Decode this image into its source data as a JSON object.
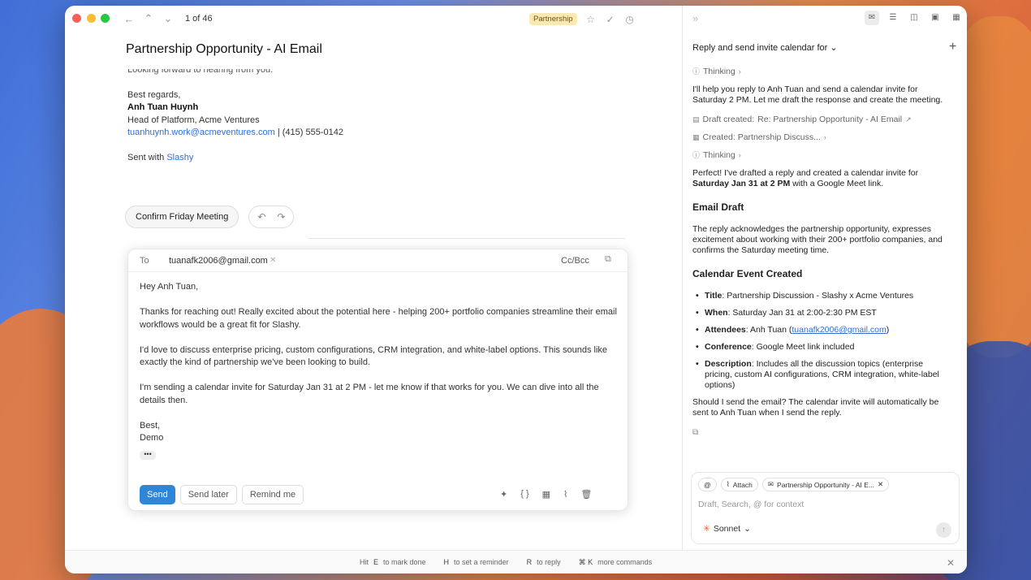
{
  "nav": {
    "counter": "1 of 46",
    "tag": "Partnership"
  },
  "email": {
    "subject": "Partnership Opportunity - AI Email",
    "closing_line": "Looking forward to hearing from you.",
    "regards": "Best regards,",
    "sender_name": "Anh Tuan Huynh",
    "sender_title": "Head of Platform, Acme Ventures",
    "sender_email": "tuanhuynh.work@acmeventures.com",
    "sender_phone": " | (415) 555-0142",
    "sent_with_prefix": "Sent with ",
    "sent_with_link": "Slashy"
  },
  "quick_reply": {
    "label": "Confirm Friday Meeting"
  },
  "compose": {
    "to_label": "To",
    "to_email": "tuanafk2006@gmail.com",
    "ccbcc": "Cc/Bcc",
    "greeting": "Hey Anh Tuan,",
    "p1": "Thanks for reaching out! Really excited about the potential here - helping 200+ portfolio companies streamline their email workflows would be a great fit for Slashy.",
    "p2": "I'd love to discuss enterprise pricing, custom configurations, CRM integration, and white-label options. This sounds like exactly the kind of partnership we've been looking to build.",
    "p3": "I'm sending a calendar invite for Saturday Jan 31 at 2 PM - let me know if that works for you. We can dive into all the details then.",
    "signoff": "Best,",
    "signature": "Demo",
    "more": "•••",
    "send": "Send",
    "send_later": "Send later",
    "remind_me": "Remind me"
  },
  "assistant": {
    "title": "Reply and send invite calendar for",
    "thinking": "Thinking",
    "intro": "I'll help you reply to Anh Tuan and send a calendar invite for Saturday 2 PM. Let me draft the response and create the meeting.",
    "draft_created_label": "Draft created:",
    "draft_created_value": "Re: Partnership Opportunity - AI Email",
    "created_label": "Created: Partnership Discuss...",
    "perfect_prefix": "Perfect! I've drafted a reply and created a calendar invite for ",
    "perfect_bold": "Saturday Jan 31 at 2 PM",
    "perfect_suffix": " with a Google Meet link.",
    "email_draft_heading": "Email Draft",
    "email_draft_text": "The reply acknowledges the partnership opportunity, expresses excitement about working with their 200+ portfolio companies, and confirms the Saturday meeting time.",
    "calendar_heading": "Calendar Event Created",
    "items": [
      {
        "label": "Title",
        "value": ": Partnership Discussion - Slashy x Acme Ventures"
      },
      {
        "label": "When",
        "value": ": Saturday Jan 31 at 2:00-2:30 PM EST"
      },
      {
        "label": "Attendees",
        "value": ": Anh Tuan (",
        "link": "tuanafk2006@gmail.com",
        "tail": ")"
      },
      {
        "label": "Conference",
        "value": ": Google Meet link included"
      },
      {
        "label": "Description",
        "value": ": Includes all the discussion topics (enterprise pricing, custom AI configurations, CRM integration, white-label options)"
      }
    ],
    "question": "Should I send the email? The calendar invite will automatically be sent to Anh Tuan when I send the reply."
  },
  "composer": {
    "chip_at": "@",
    "chip_attach": "Attach",
    "chip_context": "Partnership Opportunity - AI E...",
    "placeholder": "Draft, Search, @ for context",
    "model": "Sonnet"
  },
  "footer": {
    "hit": "Hit",
    "k1": "E",
    "t1": "to mark done",
    "k2": "H",
    "t2": "to set a reminder",
    "k3": "R",
    "t3": "to reply",
    "k4": "⌘ K",
    "t4": "more commands"
  },
  "colors": {
    "accent": "#2f86d8",
    "link": "#2f6fd0",
    "tag_bg": "#fbe9b4"
  }
}
